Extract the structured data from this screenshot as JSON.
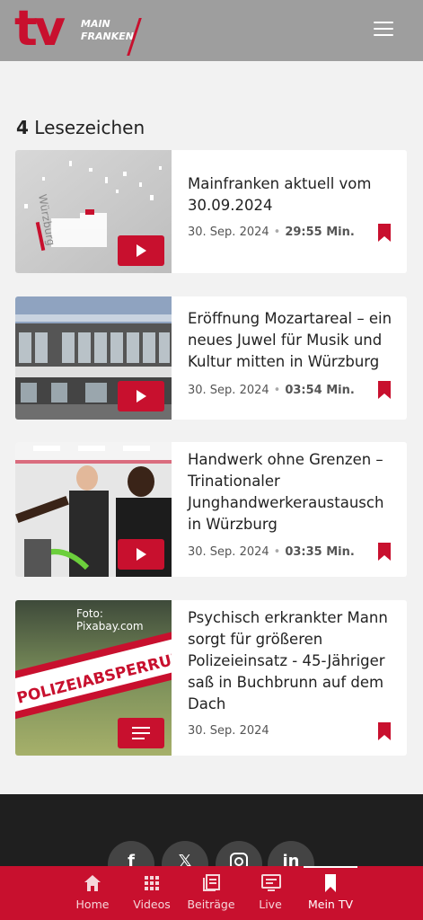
{
  "header": {
    "logo_tv": "tv",
    "logo_main": "MAIN",
    "logo_franken": "FRANKEN"
  },
  "page": {
    "count": "4",
    "title": "Lesezeichen"
  },
  "items": [
    {
      "title": "Mainfranken aktuell vom 30.09.2024",
      "date": "30. Sep. 2024",
      "duration": "29:55 Min.",
      "media": "play-icon"
    },
    {
      "title": "Eröffnung Mozartareal – ein neues Juwel für Musik und Kultur mitten in Würzburg",
      "date": "30. Sep. 2024",
      "duration": "03:54 Min.",
      "media": "play-icon"
    },
    {
      "title": "Handwerk ohne Grenzen – Trinationaler Junghandwerkeraustausch in Würzburg",
      "date": "30. Sep. 2024",
      "duration": "03:35 Min.",
      "media": "play-icon"
    },
    {
      "title": "Psychisch erkrankter Mann sorgt für größeren Polizeieinsatz - 45-Jähriger saß in Buchbrunn auf dem Dach",
      "date": "30. Sep. 2024",
      "duration": "",
      "credit": "Foto: Pixabay.com",
      "tape_text": "POLIZEIABSPERRUNG",
      "media": "article-icon"
    }
  ],
  "social": [
    "facebook-icon",
    "x-icon",
    "instagram-icon",
    "linkedin-icon"
  ],
  "nav": [
    {
      "label": "Home",
      "icon": "home-icon"
    },
    {
      "label": "Videos",
      "icon": "grid-icon"
    },
    {
      "label": "Beiträge",
      "icon": "articles-icon"
    },
    {
      "label": "Live",
      "icon": "live-icon"
    },
    {
      "label": "Mein TV",
      "icon": "bookmark-icon",
      "active": true
    }
  ],
  "colors": {
    "brand_red": "#c8102e",
    "header_gray": "#9e9e9e",
    "footer_dark": "#1f1f1f",
    "page_bg": "#f2f2f2"
  }
}
